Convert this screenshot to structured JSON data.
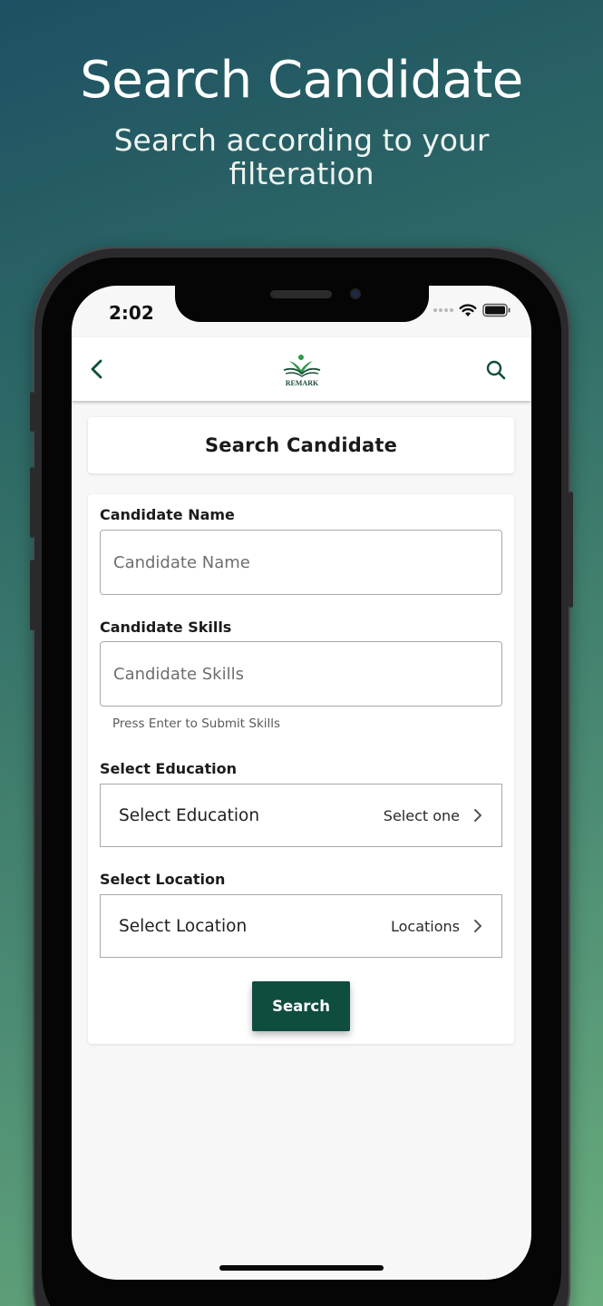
{
  "promo": {
    "title": "Search Candidate",
    "subtitle": "Search according to your filteration"
  },
  "status_bar": {
    "time": "2:02",
    "icons": [
      "signal-dots-icon",
      "wifi-icon",
      "battery-icon"
    ]
  },
  "header": {
    "back_icon": "chevron-left-icon",
    "logo_text": "REMARK",
    "search_icon": "search-icon"
  },
  "page_title": "Search Candidate",
  "form": {
    "candidate_name": {
      "label": "Candidate Name",
      "placeholder": "Candidate Name"
    },
    "candidate_skills": {
      "label": "Candidate Skills",
      "placeholder": "Candidate Skills",
      "hint": "Press Enter to Submit Skills"
    },
    "education": {
      "label": "Select Education",
      "row_label": "Select Education",
      "value": "Select one"
    },
    "location": {
      "label": "Select Location",
      "row_label": "Select Location",
      "value": "Locations"
    },
    "search_button": "Search"
  },
  "colors": {
    "brand_green": "#0f4d3f",
    "background_top": "#1d5163",
    "background_bottom": "#6aad7d"
  }
}
